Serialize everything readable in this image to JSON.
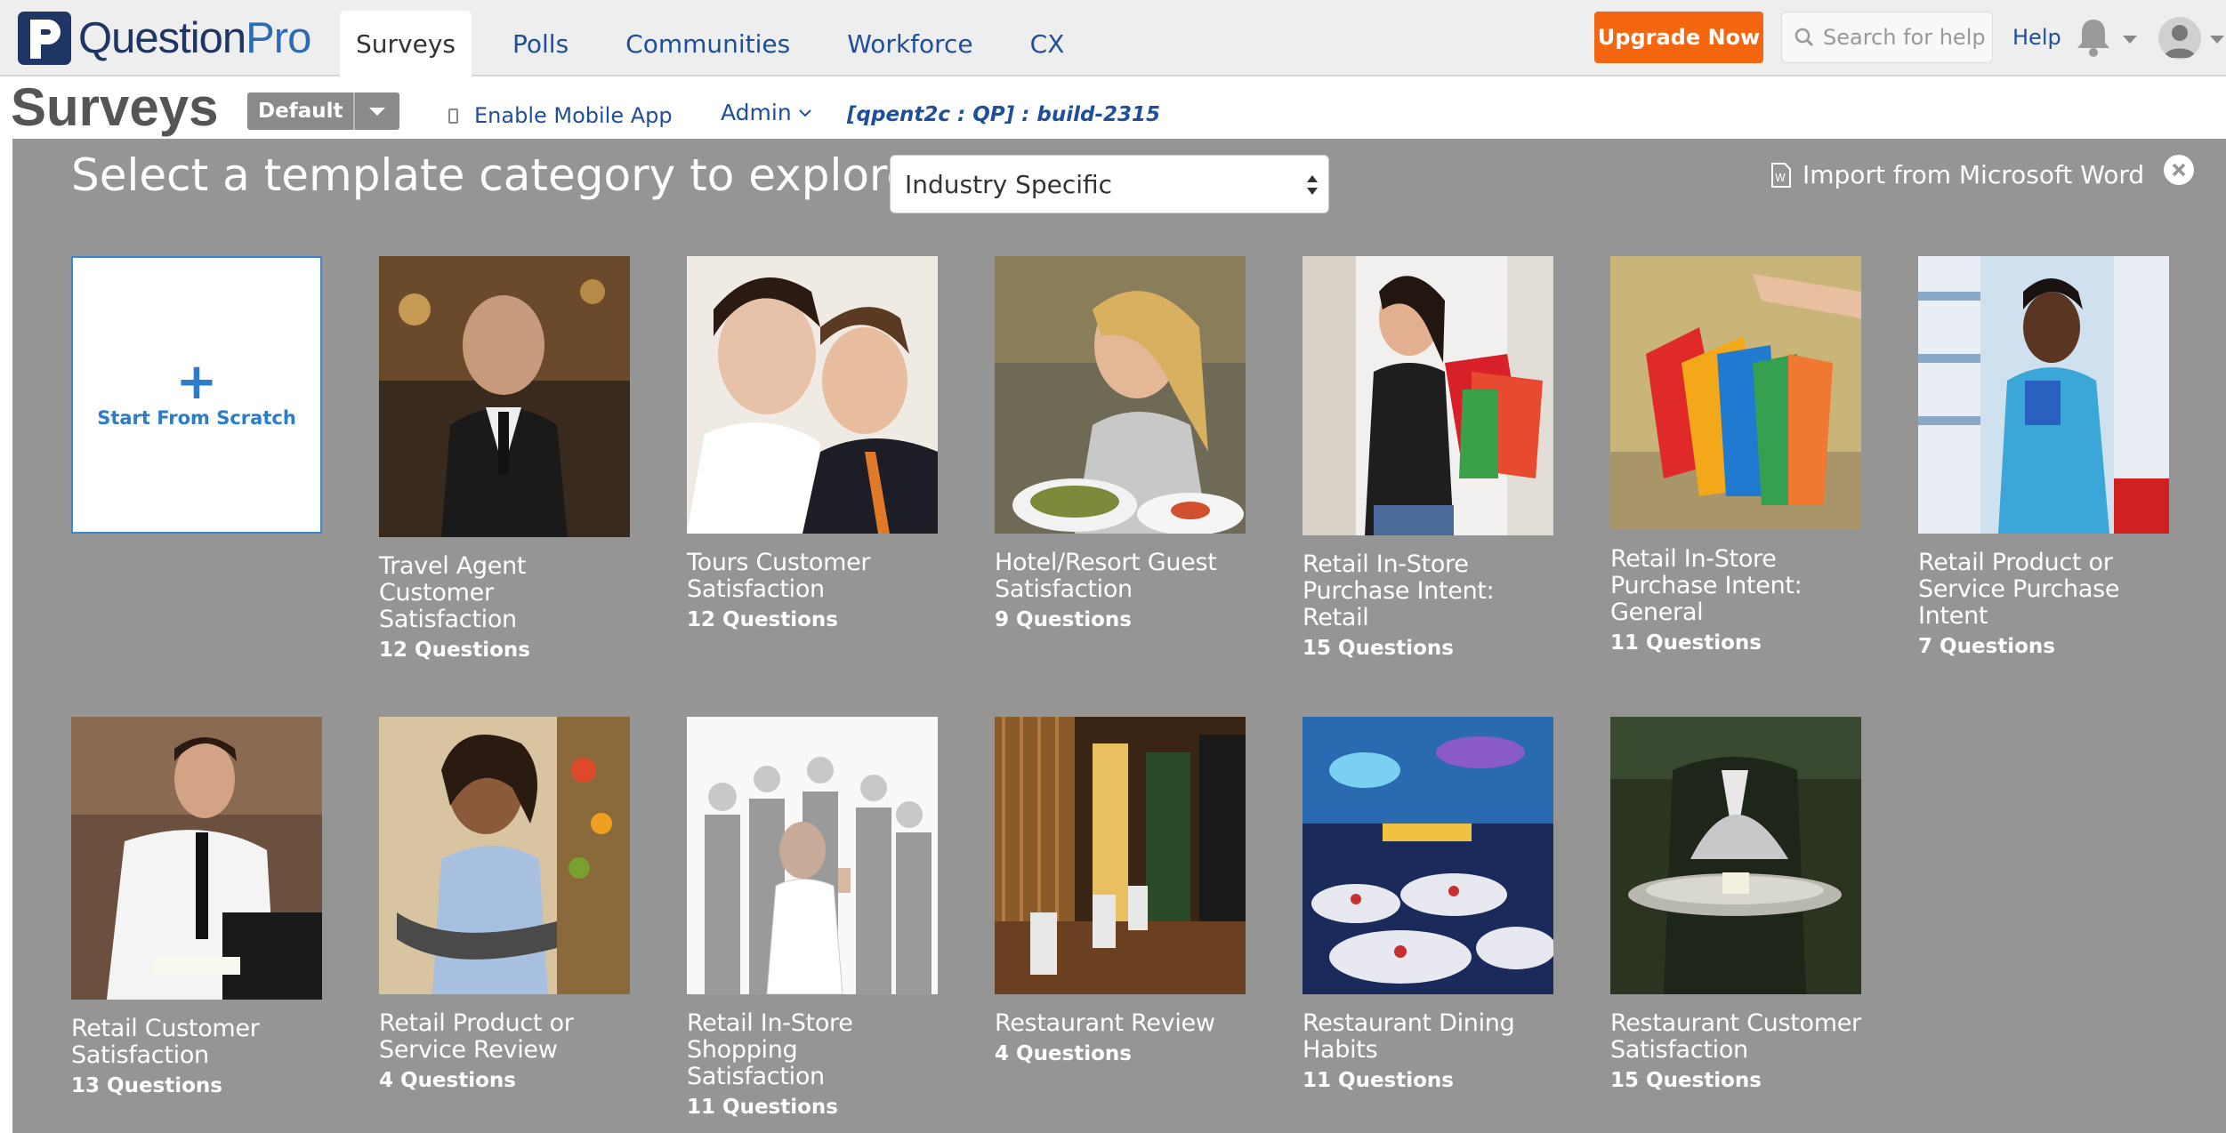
{
  "header": {
    "logo_text_a": "Question",
    "logo_text_b": "Pro",
    "nav_tabs": [
      "Surveys",
      "Polls",
      "Communities",
      "Workforce",
      "CX"
    ],
    "upgrade_label": "Upgrade Now",
    "search_placeholder": "Search for help",
    "help_label": "Help"
  },
  "subbar": {
    "title": "Surveys",
    "folder_label": "Default",
    "mobile_app_label": "Enable Mobile App",
    "admin_label": "Admin",
    "build_label": "[qpent2c : QP] :  build-2315"
  },
  "panel": {
    "title": "Select a template category to explore",
    "category_selected": "Industry Specific",
    "import_label": "Import from Microsoft Word",
    "scratch_label": "Start From Scratch"
  },
  "templates": [
    {
      "title": "Travel Agent Customer Satisfaction",
      "count": "12 Questions"
    },
    {
      "title": "Tours Customer Satisfaction",
      "count": "12 Questions"
    },
    {
      "title": "Hotel/Resort Guest Satisfaction",
      "count": "9 Questions"
    },
    {
      "title": "Retail In-Store Purchase Intent: Retail",
      "count": "15 Questions"
    },
    {
      "title": "Retail In-Store Purchase Intent: General",
      "count": "11 Questions"
    },
    {
      "title": "Retail Product or Service Purchase Intent",
      "count": "7 Questions"
    },
    {
      "title": "Retail Customer Satisfaction",
      "count": "13 Questions"
    },
    {
      "title": "Retail Product or Service Review",
      "count": "4 Questions"
    },
    {
      "title": "Retail In-Store Shopping Satisfaction",
      "count": "11 Questions"
    },
    {
      "title": "Restaurant Review",
      "count": "4 Questions"
    },
    {
      "title": "Restaurant Dining Habits",
      "count": "11 Questions"
    },
    {
      "title": "Restaurant Customer Satisfaction",
      "count": "15 Questions"
    }
  ],
  "colors": {
    "accent": "#f4660f",
    "brand": "#1f3564",
    "link": "#1f4e9a",
    "panel_bg": "#959595"
  }
}
